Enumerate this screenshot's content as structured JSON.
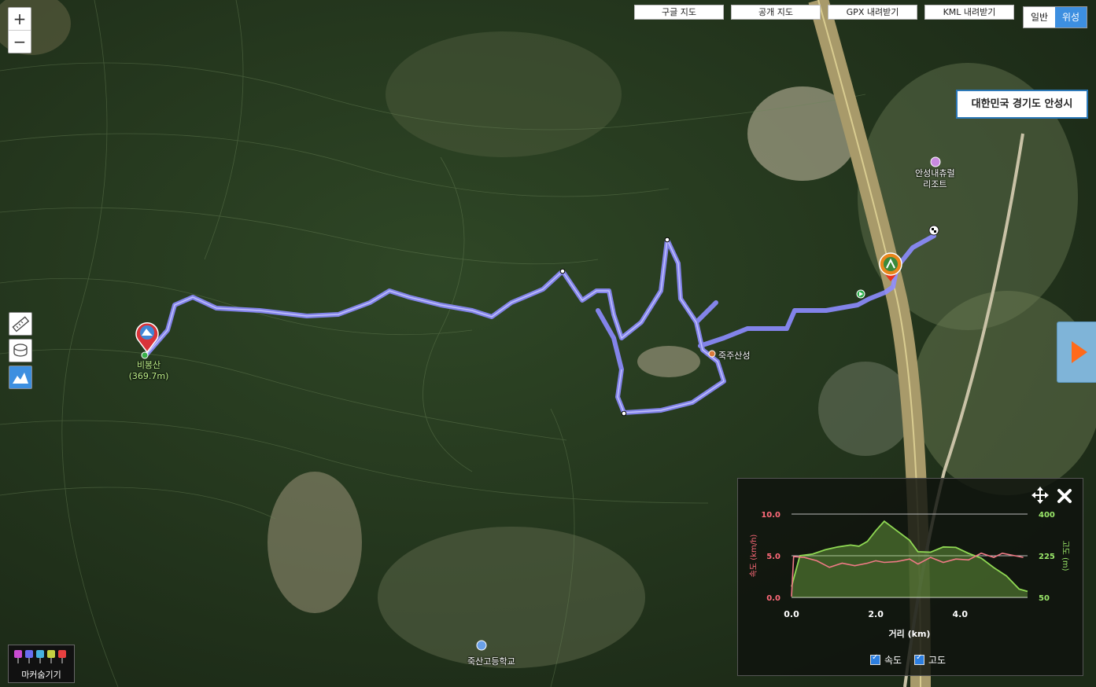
{
  "toolbar": {
    "google_map": "구글 지도",
    "public_map": "공개 지도",
    "gpx_download": "GPX 내려받기",
    "kml_download": "KML 내려받기"
  },
  "map_type": {
    "normal": "일반",
    "satellite": "위성"
  },
  "zoom": {
    "in": "+",
    "out": "−"
  },
  "region": "대한민국 경기도 안성시",
  "labels": {
    "resort": "안성내츄럴\n리조트",
    "fortress": "죽주산성",
    "school": "죽산고등학교",
    "peak_name": "비봉산",
    "peak_height": "(369.7m)"
  },
  "marker_toggle": "마커숨기기",
  "chart_data": {
    "type": "line",
    "xlabel": "거리 (km)",
    "x_ticks": [
      "0.0",
      "2.0",
      "4.0"
    ],
    "xlim": [
      0,
      5.6
    ],
    "y_left": {
      "label": "속도 (km/h)",
      "ticks": [
        "0.0",
        "5.0",
        "10.0"
      ],
      "lim": [
        0,
        10
      ],
      "color": "#ff6a7a"
    },
    "y_right": {
      "label": "고도 (m)",
      "ticks": [
        "50",
        "225",
        "400"
      ],
      "lim": [
        50,
        400
      ],
      "color": "#9be86a"
    },
    "series": [
      {
        "name": "속도",
        "color": "#f07a86",
        "x": [
          0,
          0.05,
          0.3,
          0.6,
          0.9,
          1.2,
          1.5,
          1.8,
          2.0,
          2.2,
          2.5,
          2.8,
          3.0,
          3.3,
          3.6,
          3.9,
          4.2,
          4.5,
          4.8,
          5.0,
          5.3,
          5.5
        ],
        "values": [
          0.1,
          4.9,
          4.8,
          4.4,
          3.6,
          4.1,
          3.8,
          4.1,
          4.4,
          4.2,
          4.3,
          4.6,
          4.0,
          4.8,
          4.2,
          4.6,
          4.5,
          5.3,
          4.8,
          5.3,
          5.0,
          4.8
        ]
      },
      {
        "name": "고도",
        "color": "#8fd853",
        "x": [
          0,
          0.2,
          0.5,
          0.8,
          1.1,
          1.4,
          1.6,
          1.8,
          2.0,
          2.2,
          2.5,
          2.8,
          3.0,
          3.3,
          3.6,
          3.9,
          4.2,
          4.5,
          4.8,
          5.1,
          5.4,
          5.6
        ],
        "values": [
          95,
          225,
          232,
          250,
          262,
          270,
          265,
          285,
          330,
          370,
          330,
          290,
          242,
          240,
          262,
          260,
          235,
          215,
          175,
          140,
          85,
          75
        ]
      }
    ],
    "legend": [
      "속도",
      "고도"
    ]
  }
}
